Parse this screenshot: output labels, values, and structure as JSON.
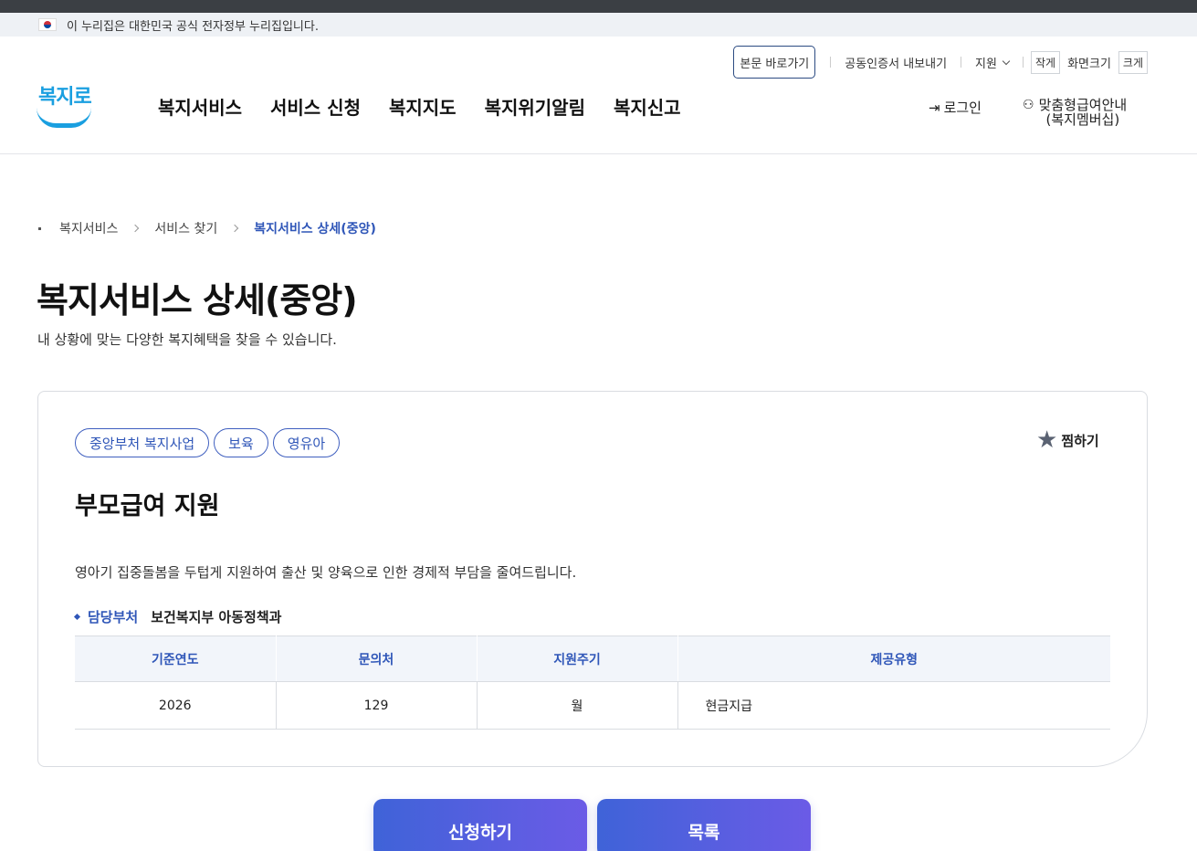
{
  "gov_banner": {
    "text": "이 누리집은 대한민국 공식 전자정부 누리집입니다."
  },
  "util": {
    "skip": "본문 바로가기",
    "cert": "공동인증서 내보내기",
    "support": "지원",
    "size_small": "작게",
    "size_label": "화면크기",
    "size_large": "크게"
  },
  "logo": {
    "text": "복지로"
  },
  "gnb": [
    "복지서비스",
    "서비스 신청",
    "복지지도",
    "복지위기알림",
    "복지신고"
  ],
  "header_right": {
    "login": "로그인",
    "member_line1": "맞춤형급여안내",
    "member_line2": "(복지멤버십)"
  },
  "breadcrumb": [
    "복지서비스",
    "서비스 찾기",
    "복지서비스 상세(중앙)"
  ],
  "page": {
    "title": "복지서비스 상세(중앙)",
    "description": "내 상황에 맞는 다양한 복지혜택을 찾을 수 있습니다."
  },
  "card": {
    "tags": [
      "중앙부처 복지사업",
      "보육",
      "영유아"
    ],
    "bookmark": "찜하기",
    "title": "부모급여 지원",
    "description": "영아기 집중돌봄을 두텁게 지원하여 출산 및 양육으로 인한 경제적 부담을 줄여드립니다.",
    "dept_label": "담당부처",
    "dept_value": "보건복지부 아동정책과",
    "table": {
      "headers": [
        "기준연도",
        "문의처",
        "지원주기",
        "제공유형"
      ],
      "row": [
        "2026",
        "129",
        "월",
        "현금지급"
      ]
    }
  },
  "buttons": {
    "apply": "신청하기",
    "list": "목록"
  },
  "icons": {
    "star": "star-icon",
    "login": "login-icon",
    "member": "user-plus-icon",
    "flag": "korea-flag-icon"
  }
}
